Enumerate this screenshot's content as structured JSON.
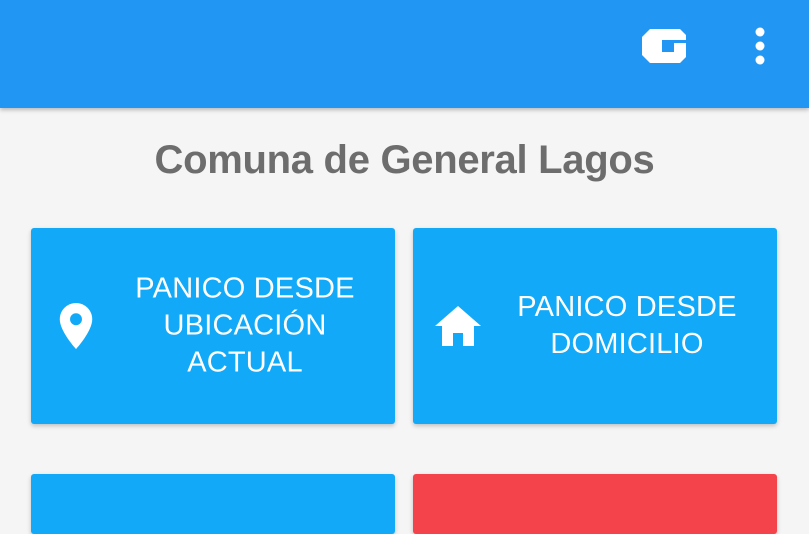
{
  "app": {
    "colors": {
      "appbar": "#2196f3",
      "card_blue": "#12aaf8",
      "card_red": "#f4434b",
      "title_text": "#6d6d6d",
      "background": "#f5f5f5"
    },
    "icons": {
      "logo": "g-logo-icon",
      "menu": "more-vert-icon"
    }
  },
  "main": {
    "title": "Comuna de General Lagos",
    "cards": [
      {
        "id": "ubicacion",
        "icon": "location-pin-icon",
        "label_lines": [
          "PANICO DESDE",
          "UBICACIÓN",
          "ACTUAL"
        ]
      },
      {
        "id": "domicilio",
        "icon": "home-icon",
        "label_lines": [
          "PANICO DESDE",
          "DOMICILIO"
        ]
      }
    ]
  }
}
